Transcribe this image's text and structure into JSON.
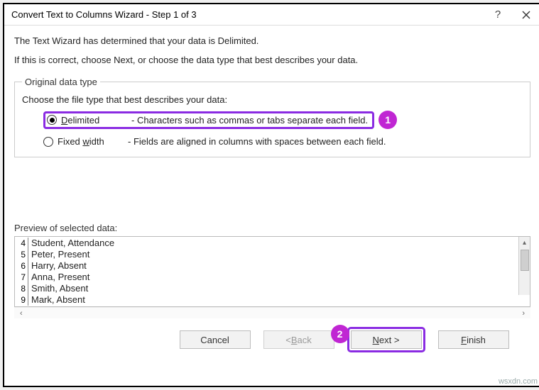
{
  "title": "Convert Text to Columns Wizard - Step 1 of 3",
  "intro1": "The Text Wizard has determined that your data is Delimited.",
  "intro2": "If this is correct, choose Next, or choose the data type that best describes your data.",
  "group_legend": "Original data type",
  "choose_label": "Choose the file type that best describes your data:",
  "options": {
    "delimited": {
      "label_pre": "D",
      "label_rest": "elimited",
      "desc": "- Characters such as commas or tabs separate each field."
    },
    "fixed": {
      "label_pre": "Fixed ",
      "label_u": "w",
      "label_rest": "idth",
      "desc": "- Fields are aligned in columns with spaces between each field."
    }
  },
  "annotations": {
    "badge1": "1",
    "badge2": "2"
  },
  "preview_label": "Preview of selected data:",
  "preview_rows": [
    {
      "n": "4",
      "t": "Student, Attendance"
    },
    {
      "n": "5",
      "t": "Peter, Present"
    },
    {
      "n": "6",
      "t": "Harry, Absent"
    },
    {
      "n": "7",
      "t": "Anna, Present"
    },
    {
      "n": "8",
      "t": "Smith, Absent"
    },
    {
      "n": "9",
      "t": "Mark, Absent"
    }
  ],
  "buttons": {
    "cancel": "Cancel",
    "back_pre": "< ",
    "back_u": "B",
    "back_rest": "ack",
    "next_u": "N",
    "next_rest": "ext >",
    "finish_u": "F",
    "finish_rest": "inish"
  },
  "watermark": "wsxdn.com"
}
